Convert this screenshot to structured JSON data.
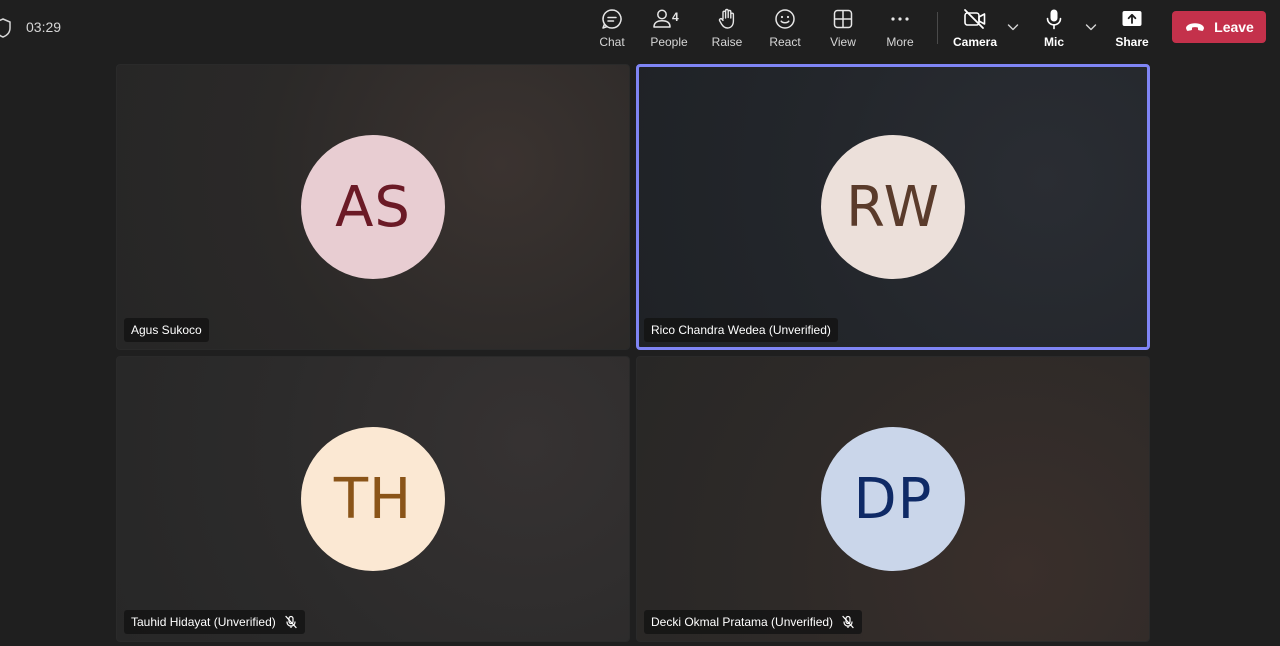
{
  "header": {
    "timer": "03:29",
    "people_count": "4",
    "toolbar": {
      "chat": "Chat",
      "people": "People",
      "raise": "Raise",
      "react": "React",
      "view": "View",
      "more": "More",
      "camera": "Camera",
      "mic": "Mic",
      "share": "Share",
      "leave": "Leave"
    },
    "colors": {
      "leave_bg": "#c4314b",
      "active_border": "#7f85f5"
    }
  },
  "participants": [
    {
      "initials": "AS",
      "name": "Agus Sukoco",
      "muted": false,
      "active": false,
      "avatar_bg": "#e8cdd2",
      "avatar_fg": "#6b1a26",
      "bg": "radial-gradient(circle at 75% 35%, #3b3330 0%, #2b2928 55%, #262626 100%)"
    },
    {
      "initials": "RW",
      "name": "Rico Chandra Wedea (Unverified)",
      "muted": false,
      "active": true,
      "avatar_bg": "#ece0da",
      "avatar_fg": "#5a3b2b",
      "bg": "radial-gradient(circle at 80% 40%, #2a2d33 0%, #23262b 55%, #1f2226 100%)"
    },
    {
      "initials": "TH",
      "name": "Tauhid Hidayat (Unverified)",
      "muted": true,
      "active": false,
      "avatar_bg": "#fbe8d3",
      "avatar_fg": "#8a5418",
      "bg": "radial-gradient(circle at 80% 30%, #363232 0%, #2c2b2b 55%, #272727 100%)"
    },
    {
      "initials": "DP",
      "name": "Decki Okmal Pratama (Unverified)",
      "muted": true,
      "active": false,
      "avatar_bg": "#cad6ea",
      "avatar_fg": "#0f2a66",
      "bg": "radial-gradient(circle at 75% 75%, #3a2f2b 0%, #2e2a28 55%, #282726 100%)"
    }
  ]
}
